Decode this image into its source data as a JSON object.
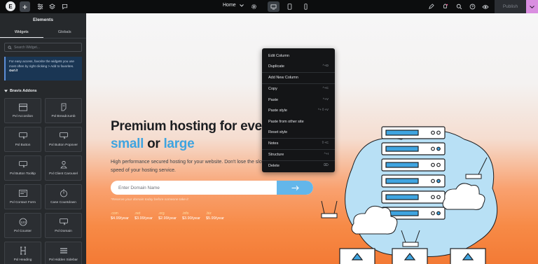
{
  "topbar": {
    "logo_letter": "E",
    "add_label": "+",
    "page_name": "Home",
    "publish_label": "Publish"
  },
  "sidebar": {
    "title": "Elements",
    "tabs": [
      {
        "label": "Widgets",
        "active": true
      },
      {
        "label": "Globals",
        "active": false
      }
    ],
    "search_placeholder": "Search Widget...",
    "tip_text": "For easy access, favorite the widgets you use most often by right clicking > Add to favorites.",
    "tip_link": "Got it",
    "section_title": "Bravis Addons",
    "widgets": [
      {
        "label": "Pxl Accordion",
        "icon": "accordion-icon"
      },
      {
        "label": "Pxl Breadcrumb",
        "icon": "breadcrumb-icon"
      },
      {
        "label": "Pxl Button",
        "icon": "button-icon"
      },
      {
        "label": "Pxl Button Popover",
        "icon": "button-popover-icon"
      },
      {
        "label": "Pxl Button Tooltip",
        "icon": "button-tooltip-icon"
      },
      {
        "label": "Pxl Client Carousel",
        "icon": "client-carousel-icon"
      },
      {
        "label": "Pxl Contact Form",
        "icon": "contact-form-icon"
      },
      {
        "label": "Case Countdown",
        "icon": "countdown-icon"
      },
      {
        "label": "Pxl Counter",
        "icon": "counter-icon"
      },
      {
        "label": "Pxl Domain",
        "icon": "domain-icon"
      },
      {
        "label": "Pxl Heading",
        "icon": "heading-icon"
      },
      {
        "label": "Pxl Hidden Sidebar",
        "icon": "hidden-sidebar-icon"
      }
    ]
  },
  "hero": {
    "title_line1": "Premium hosting for eve",
    "title_word1": "small",
    "title_word2": " or ",
    "title_word3": "large",
    "description": "High performance secured hosting for your website. Don't lose the slowest speed of your hosting service.",
    "domain_placeholder": "Enter Domain Name",
    "reserve_note": "*Reserve your domain today before someone take it",
    "tlds": [
      {
        "ext": ".com",
        "price": "$4.99/year"
      },
      {
        "ext": ".net",
        "price": "$3.99/year"
      },
      {
        "ext": ".org",
        "price": "$2.99/year"
      },
      {
        "ext": ".info",
        "price": "$3.90/year"
      },
      {
        "ext": ".biz",
        "price": "$5.99/year"
      }
    ]
  },
  "context_menu": {
    "items": [
      {
        "label": "Edit Column",
        "shortcut": ""
      },
      {
        "label": "Duplicate",
        "shortcut": "^+D"
      },
      {
        "label": "Add New Column",
        "shortcut": ""
      },
      {
        "label": "Copy",
        "shortcut": "^+C"
      },
      {
        "label": "Paste",
        "shortcut": "^+V"
      },
      {
        "label": "Paste style",
        "shortcut": "^+⇧+V"
      },
      {
        "label": "Paste from other site",
        "shortcut": ""
      },
      {
        "label": "Reset style",
        "shortcut": ""
      },
      {
        "label": "Notes",
        "shortcut": "⇧+C"
      },
      {
        "label": "Structure",
        "shortcut": "^+I"
      },
      {
        "label": "Delete",
        "shortcut": "⌦"
      }
    ]
  },
  "colors": {
    "topbar_bg": "#0c0d0e",
    "sidebar_bg": "#26292c",
    "accent_blue": "#3fa4e0",
    "publish_accent": "#d98ee0",
    "hero_orange": "#f37a35"
  }
}
